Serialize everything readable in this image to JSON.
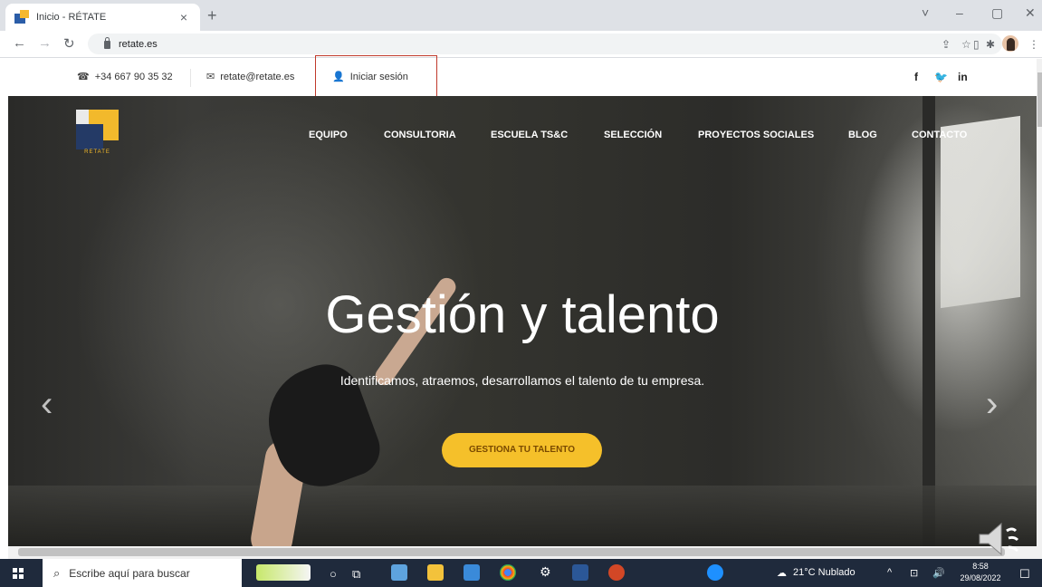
{
  "browser": {
    "tab_title": "Inicio - RÉTATE",
    "tab_close": "×",
    "new_tab": "+",
    "url": "retate.es",
    "window_controls": [
      "˅",
      "–",
      "▢",
      "✕"
    ]
  },
  "site": {
    "phone": "+34 667 90 35 32",
    "email": "retate@retate.es",
    "login": "Iniciar sesión",
    "social": [
      "f",
      "in"
    ],
    "logo_text": "RETATE",
    "menu": [
      "EQUIPO",
      "CONSULTORIA",
      "ESCUELA TS&C",
      "SELECCIÓN",
      "PROYECTOS SOCIALES",
      "BLOG",
      "CONTACTO"
    ],
    "hero": {
      "title": "Gestión y talento",
      "subtitle": "Identificamos, atraemos, desarrollamos el talento de tu empresa.",
      "cta": "GESTIONA TU TALENTO",
      "prev": "‹",
      "next": "›"
    }
  },
  "taskbar": {
    "search_placeholder": "Escribe aquí para buscar",
    "weather": "21°C  Nublado",
    "time": "8:58",
    "date": "29/08/2022"
  },
  "colors": {
    "cta": "#f5c02a",
    "logo_blue": "#243a66",
    "logo_yellow": "#f2b92c",
    "login_highlight": "#c0392b",
    "taskbar": "#1f2a3c"
  }
}
